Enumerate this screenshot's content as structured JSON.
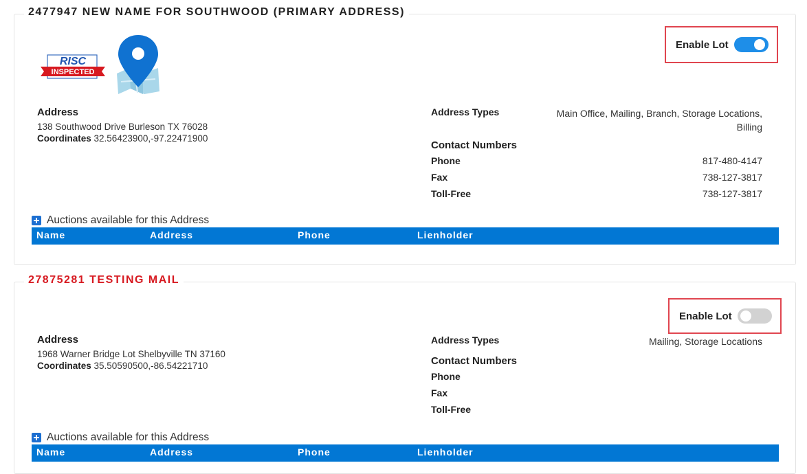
{
  "cards": [
    {
      "title": "2477947 NEW NAME FOR SOUTHWOOD (PRIMARY ADDRESS)",
      "enable_lot_label": "Enable Lot",
      "enable_lot_on": true,
      "logo_text_top": "RISC",
      "logo_text_bottom": "INSPECTED",
      "address_heading": "Address",
      "address_line": "138 Southwood Drive Burleson TX 76028",
      "coordinates_label": "Coordinates",
      "coordinates_value": "32.56423900,-97.22471900",
      "address_types_label": "Address Types",
      "address_types_value": "Main Office, Mailing, Branch, Storage Locations, Billing",
      "contact_numbers_label": "Contact Numbers",
      "phone_label": "Phone",
      "phone_value": "817-480-4147",
      "fax_label": "Fax",
      "fax_value": "738-127-3817",
      "tollfree_label": "Toll-Free",
      "tollfree_value": "738-127-3817",
      "auctions_label": "Auctions available for this Address",
      "table_headers": [
        "Name",
        "Address",
        "Phone",
        "Lienholder"
      ]
    },
    {
      "title": "27875281 TESTING MAIL",
      "enable_lot_label": "Enable Lot",
      "enable_lot_on": false,
      "address_heading": "Address",
      "address_line": "1968 Warner Bridge Lot Shelbyville TN 37160",
      "coordinates_label": "Coordinates",
      "coordinates_value": "35.50590500,-86.54221710",
      "address_types_label": "Address Types",
      "address_types_value": "Mailing, Storage Locations",
      "contact_numbers_label": "Contact Numbers",
      "phone_label": "Phone",
      "phone_value": "",
      "fax_label": "Fax",
      "fax_value": "",
      "tollfree_label": "Toll-Free",
      "tollfree_value": "",
      "auctions_label": "Auctions available for this Address",
      "table_headers": [
        "Name",
        "Address",
        "Phone",
        "Lienholder"
      ]
    }
  ],
  "colors": {
    "title_primary": "#222222",
    "title_secondary": "#d71920",
    "toggle_on": "#1e8ee8",
    "toggle_off": "#d2d2d2",
    "table_header_bg": "#0277d4",
    "highlight_border": "#e0454f"
  }
}
